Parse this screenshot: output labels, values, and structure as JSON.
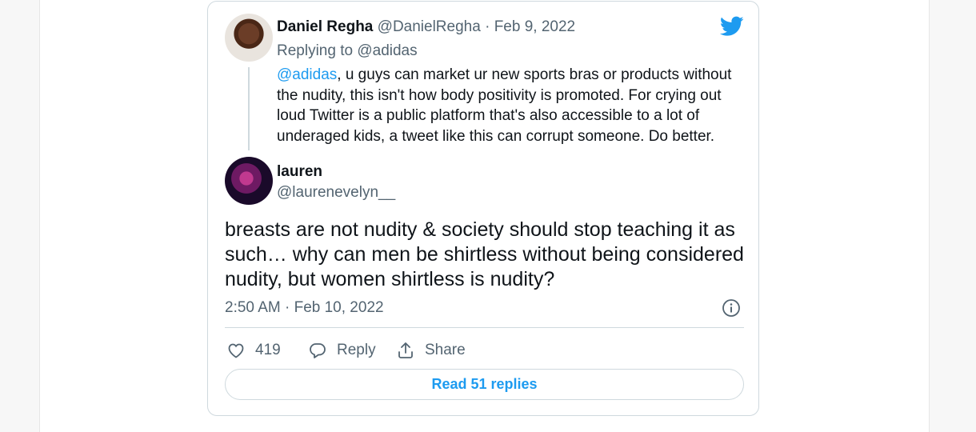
{
  "quoted_tweet": {
    "author_name": "Daniel Regha",
    "author_handle": "@DanielRegha",
    "date": "Feb 9, 2022",
    "replying_prefix": "Replying to",
    "replying_to": "@adidas",
    "mention": "@adidas",
    "text": ", u guys can market ur new sports bras or products without the nudity, this isn't how body positivity is promoted. For crying out loud Twitter is a public platform that's also accessible to a lot of underaged kids, a tweet like this can corrupt someone. Do better."
  },
  "main_tweet": {
    "author_name": "lauren",
    "author_handle": "@laurenevelyn__",
    "text": "breasts are not nudity & society should stop teaching it as such… why can men be shirtless without being considered nudity, but women shirtless is nudity?",
    "timestamp": "2:50 AM · Feb 10, 2022"
  },
  "actions": {
    "like_count": "419",
    "reply_label": "Reply",
    "share_label": "Share"
  },
  "read_replies_label": "Read 51 replies",
  "colors": {
    "accent": "#1d9bf0",
    "muted": "#536471",
    "border": "#cfd9de"
  },
  "icons": [
    "twitter-bird-icon",
    "info-icon",
    "heart-icon",
    "reply-icon",
    "share-icon"
  ]
}
